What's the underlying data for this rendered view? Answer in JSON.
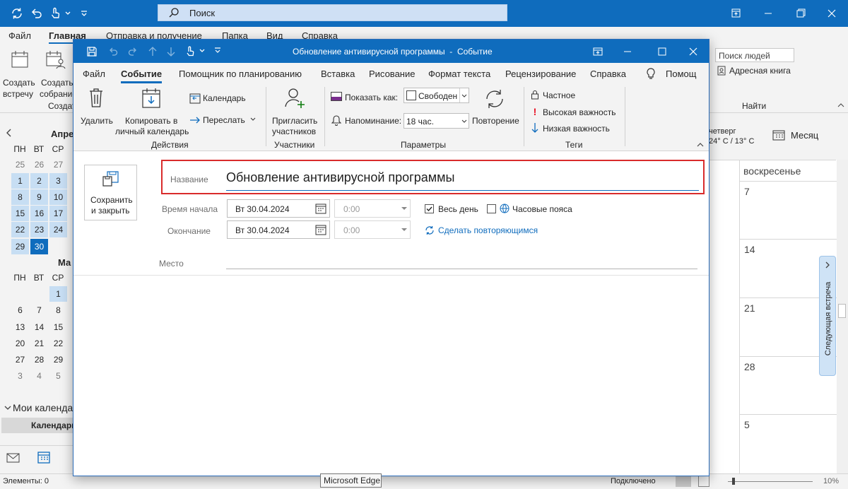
{
  "main": {
    "search_placeholder": "Поиск",
    "tabs": [
      "Файл",
      "Главная",
      "Отправка и получение",
      "Папка",
      "Вид",
      "Справка"
    ],
    "ribbon": {
      "new_meeting": [
        "Создать",
        "встречу"
      ],
      "new_event": [
        "Создать",
        "собрание"
      ],
      "group_create": "Создат",
      "people_search": "Поиск людей",
      "address_book": "Адресная книга",
      "group_find": "Найти"
    },
    "calendar": {
      "month1": "Апре",
      "month2": "Ма",
      "weekdays": [
        "ПН",
        "ВТ",
        "СР"
      ],
      "april_rows": [
        [
          "25",
          "26",
          "27"
        ],
        [
          "1",
          "2",
          "3"
        ],
        [
          "8",
          "9",
          "10"
        ],
        [
          "15",
          "16",
          "17"
        ],
        [
          "22",
          "23",
          "24"
        ],
        [
          "29",
          "30",
          ""
        ]
      ],
      "may_rows": [
        [
          "",
          "",
          "1"
        ],
        [
          "6",
          "7",
          "8"
        ],
        [
          "13",
          "14",
          "15"
        ],
        [
          "20",
          "21",
          "22"
        ],
        [
          "27",
          "28",
          "29"
        ],
        [
          "3",
          "4",
          "5"
        ]
      ],
      "my_calendars": "Мои календа",
      "calendar_item": "Календарь"
    },
    "weather": {
      "day": "четверг",
      "temp": "24° C / 13° C"
    },
    "view": "Месяц",
    "week_header": "воскресенье",
    "sunday_dates": [
      "7",
      "14",
      "21",
      "28",
      "5"
    ],
    "next_appointment": "Следующая встреча",
    "status_left": "Элементы: 0",
    "status_conn": "Подключено",
    "zoom": "10%",
    "tooltip": "Microsoft Edge"
  },
  "dialog": {
    "title": "Обновление антивирусной программы  -  Событие",
    "tabs": [
      "Файл",
      "Событие",
      "Помощник по планированию",
      "Вставка",
      "Рисование",
      "Формат текста",
      "Рецензирование",
      "Справка",
      "Помощ"
    ],
    "ribbon": {
      "delete": "Удалить",
      "copy": [
        "Копировать в",
        "личный календарь"
      ],
      "calendar": "Календарь",
      "forward": "Переслать",
      "group_actions": "Действия",
      "invite": [
        "Пригласить",
        "участников"
      ],
      "group_attendees": "Участники",
      "show_as_label": "Показать как:",
      "show_as_value": "Свободен",
      "reminder_label": "Напоминание:",
      "reminder_value": "18 час.",
      "recurrence": "Повторение",
      "group_options": "Параметры",
      "private": "Частное",
      "high": "Высокая важность",
      "low": "Низкая важность",
      "group_tags": "Теги"
    },
    "save_close": [
      "Сохранить",
      "и закрыть"
    ],
    "title_label": "Название",
    "title_value": "Обновление антивирусной программы",
    "start_label": "Время начала",
    "start_date": "Вт 30.04.2024",
    "start_time": "0:00",
    "all_day": "Весь день",
    "all_day_checked": true,
    "time_zones": "Часовые пояса",
    "end_label": "Окончание",
    "end_date": "Вт 30.04.2024",
    "end_time": "0:00",
    "make_recurring": "Сделать повторяющимся",
    "location_label": "Место"
  },
  "colors": {
    "accent": "#0f6cbd",
    "highlight": "#e81123"
  }
}
